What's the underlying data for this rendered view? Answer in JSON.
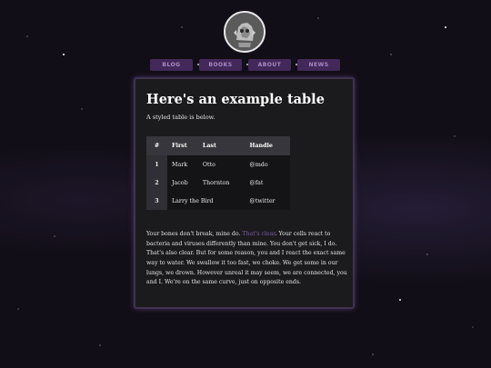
{
  "nav": {
    "items": [
      {
        "label": "BLOG"
      },
      {
        "label": "BOOKS"
      },
      {
        "label": "ABOUT"
      },
      {
        "label": "NEWS"
      }
    ]
  },
  "main": {
    "title": "Here's an example table",
    "subtitle": "A styled table is below.",
    "table": {
      "headers": [
        "#",
        "First",
        "Last",
        "Handle"
      ],
      "rows": [
        [
          "1",
          "Mark",
          "Otto",
          "@mdo"
        ],
        [
          "2",
          "Jacob",
          "Thornton",
          "@fat"
        ],
        [
          "3",
          "Larry the Bird",
          "",
          "@twitter"
        ]
      ]
    },
    "paragraph": {
      "before": "Your bones don't break, mine do. ",
      "link": "That's clear",
      "after": ". Your cells react to bacteria and viruses differently than mine. You don't get sick, I do. That's also clear. But for some reason, you and I react the exact same way to water. We swallow it too fast, we choke. We get some in our lungs, we drown. However unreal it may seem, we are connected, you and I. We're on the same curve, just on opposite ends."
    }
  },
  "colors": {
    "accent": "#43285a",
    "nav_text": "#a98bc8",
    "link": "#7d5aa8",
    "card_bg": "#1b1b1d"
  }
}
